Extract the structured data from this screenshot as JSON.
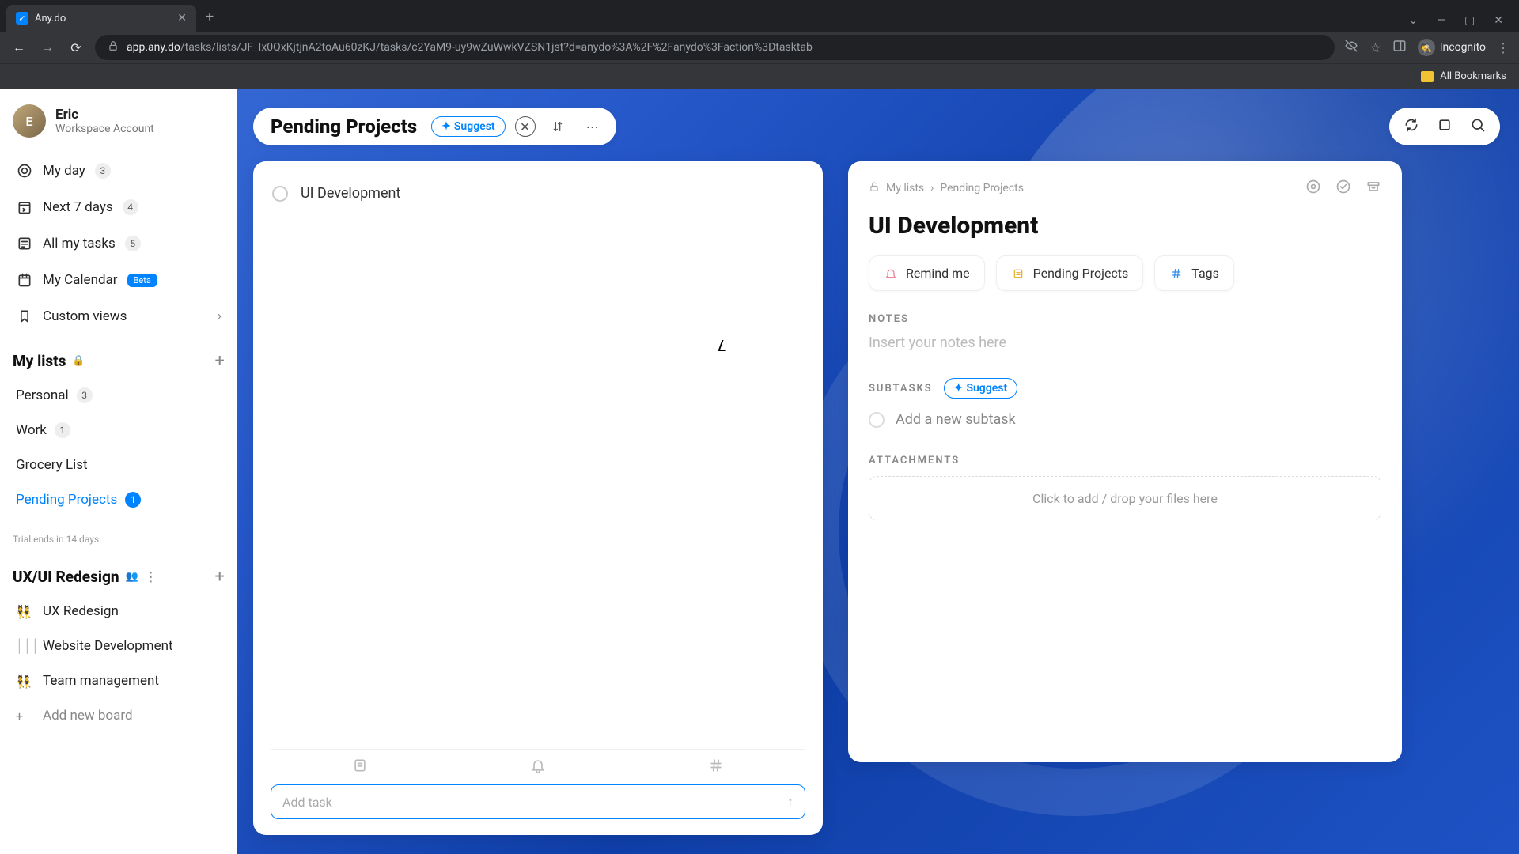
{
  "browser": {
    "tab_title": "Any.do",
    "url_host": "app.any.do",
    "url_path": "/tasks/lists/JF_Ix0QxKjtjnA2toAu60zKJ/tasks/c2YaM9-uy9wZuWwkVZSN1jst?d=anydo%3A%2F%2Fanydo%3Faction%3Dtasktab",
    "incognito_label": "Incognito",
    "bookmarks_label": "All Bookmarks"
  },
  "user": {
    "name": "Eric",
    "subtitle": "Workspace Account",
    "initials": "E"
  },
  "nav": {
    "myday": {
      "label": "My day",
      "count": "3"
    },
    "next7": {
      "label": "Next 7 days",
      "count": "4"
    },
    "all": {
      "label": "All my tasks",
      "count": "5"
    },
    "cal": {
      "label": "My Calendar",
      "badge": "Beta"
    },
    "custom": {
      "label": "Custom views"
    }
  },
  "mylists": {
    "title": "My lists",
    "items": [
      {
        "label": "Personal",
        "count": "3"
      },
      {
        "label": "Work",
        "count": "1"
      },
      {
        "label": "Grocery List",
        "count": ""
      },
      {
        "label": "Pending Projects",
        "count": "1",
        "active": true
      }
    ]
  },
  "trial": "Trial ends in 14 days",
  "workspace": {
    "title": "UX/UI Redesign",
    "boards": [
      {
        "icon": "👯",
        "label": "UX Redesign"
      },
      {
        "icon": "│││",
        "label": "Website Development"
      },
      {
        "icon": "👯",
        "label": "Team management"
      }
    ],
    "add_label": "Add new board"
  },
  "header": {
    "title": "Pending Projects",
    "suggest": "Suggest"
  },
  "tasklist": {
    "tasks": [
      {
        "title": "UI Development"
      }
    ],
    "add_placeholder": "Add task"
  },
  "detail": {
    "crumb_root": "My lists",
    "crumb_list": "Pending Projects",
    "title": "UI Development",
    "chip_remind": "Remind me",
    "chip_list": "Pending Projects",
    "chip_tags": "Tags",
    "notes_label": "NOTES",
    "notes_placeholder": "Insert your notes here",
    "subtasks_label": "SUBTASKS",
    "subtasks_suggest": "Suggest",
    "subtask_placeholder": "Add a new subtask",
    "attach_label": "ATTACHMENTS",
    "attach_placeholder": "Click to add / drop your files here"
  }
}
